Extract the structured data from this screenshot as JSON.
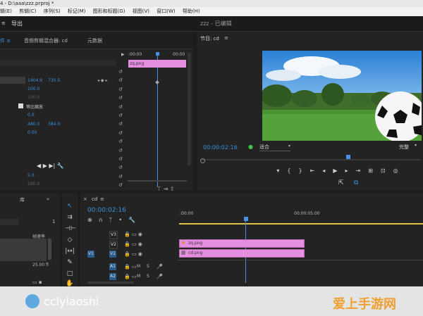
{
  "window": {
    "title": "4 - D:\\aaa\\zzz.prproj *"
  },
  "menu": [
    "辑(E)",
    "剪辑(C)",
    "序列(S)",
    "标记(M)",
    "图形和标题(G)",
    "视图(V)",
    "窗口(W)",
    "帮助(H)"
  ],
  "workspace": {
    "export_label": "导出",
    "project_title": "zzz - 已编辑"
  },
  "left_panel": {
    "tabs": [
      "件 ≡",
      "音频剪辑混合器: cd",
      "元数据"
    ],
    "timecode_start": ":00:00",
    "timecode_end": "00:00",
    "clip_label": "zq.png",
    "values": {
      "position_x": "1404.9",
      "position_y": "735.5",
      "scale": "100.0",
      "scale_width": "100.0",
      "uniform_scale_label": "等比缩放",
      "rotation": "0.0",
      "anchor_x": "480.0",
      "anchor_y": "384.0",
      "anti_flicker": "0.00",
      "opacity_val": "5.0",
      "bottom_val": "100.0"
    }
  },
  "program_monitor": {
    "title": "节目: cd",
    "timecode": "00:00:02:16",
    "fit": "适合",
    "quality": "完整"
  },
  "timeline": {
    "tab": "cd",
    "timecode": "00:00:02:16",
    "ruler": [
      ":00:00",
      "00:00:05:00"
    ],
    "tracks": {
      "v3": "V3",
      "v2": "V2",
      "v1": "V1",
      "v1_src": "V1",
      "a1": "A1",
      "a2": "A2",
      "m": "M",
      "s": "S"
    },
    "clips": {
      "v2_clip": "zq.png",
      "v1_clip": "cd.png"
    }
  },
  "bottom_left": {
    "label1": "帧速率",
    "val": "25.00 fi",
    "num": "1"
  },
  "watermark": {
    "left": "cclylaoshi",
    "right": "爱上手游网"
  },
  "colors": {
    "accent_blue": "#3b8fd9",
    "clip_pink": "#e68fe0",
    "playhead": "#4a8fe6",
    "watermark_orange": "#f0a030"
  }
}
